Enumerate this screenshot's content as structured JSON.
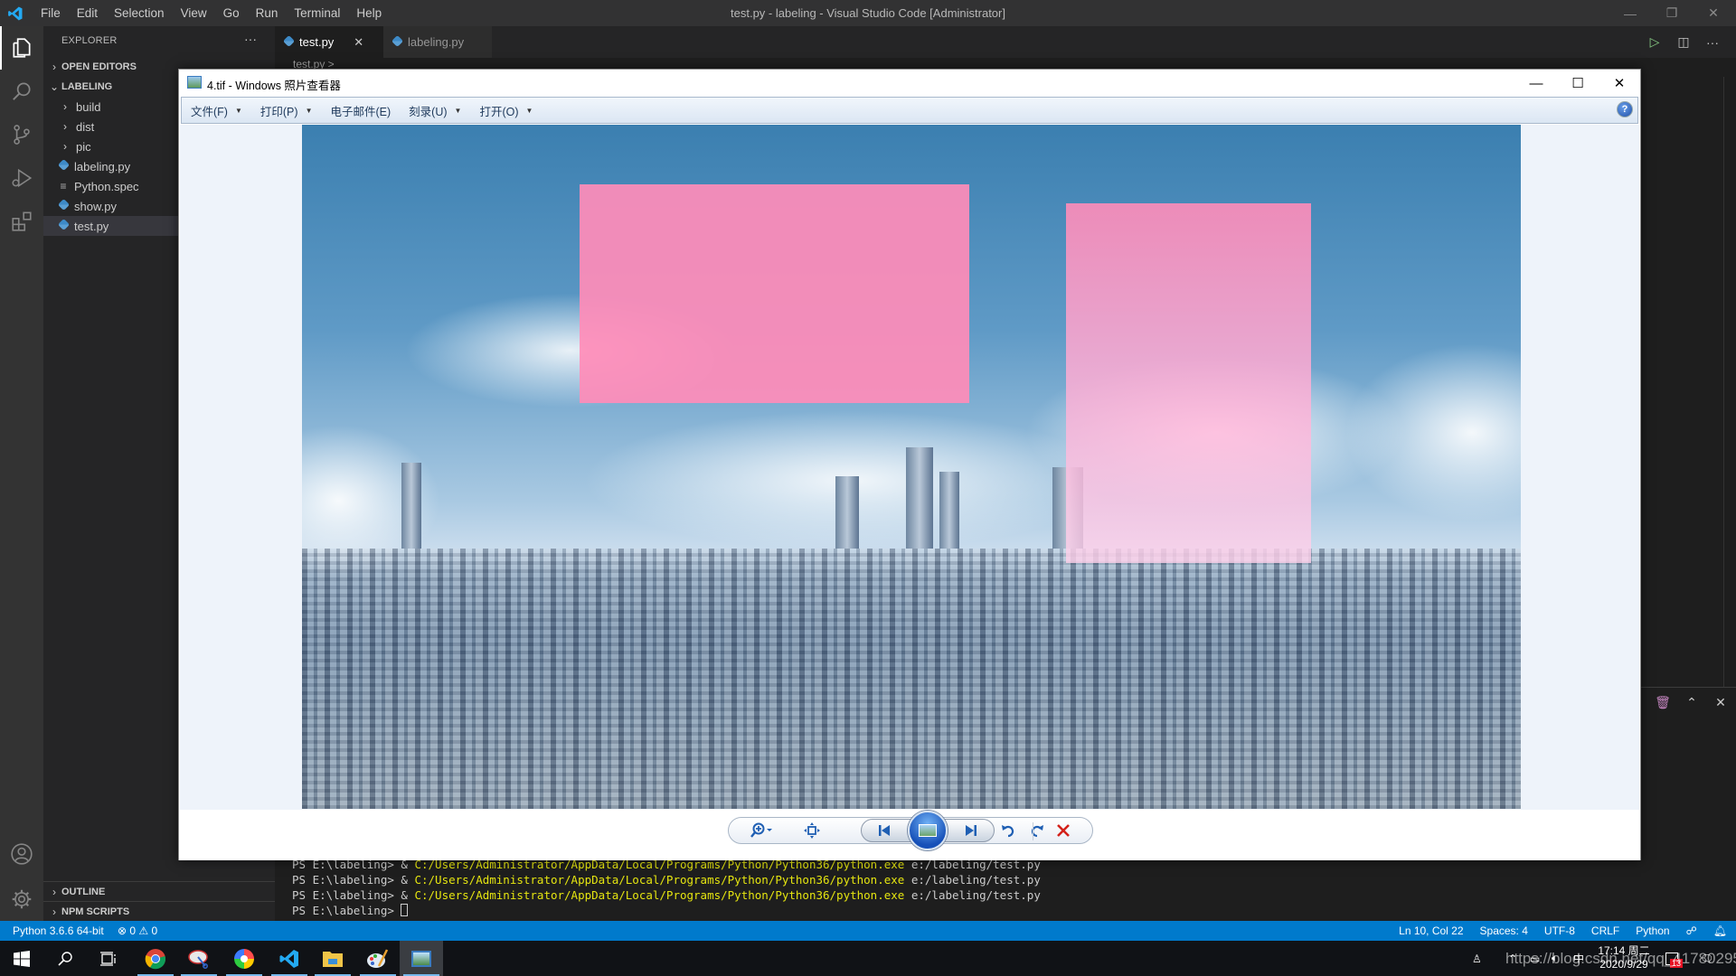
{
  "vscode": {
    "window_title": "test.py - labeling - Visual Studio Code [Administrator]",
    "menu": [
      "File",
      "Edit",
      "Selection",
      "View",
      "Go",
      "Run",
      "Terminal",
      "Help"
    ],
    "window_controls": {
      "minimize": "—",
      "restore": "❐",
      "close": "✕"
    },
    "activity_bar": [
      {
        "name": "explorer",
        "icon": "files-icon",
        "active": true
      },
      {
        "name": "search",
        "icon": "search-icon"
      },
      {
        "name": "source-control",
        "icon": "source-control-icon"
      },
      {
        "name": "run-debug",
        "icon": "run-debug-icon"
      },
      {
        "name": "extensions",
        "icon": "extensions-icon"
      },
      {
        "name": "accounts",
        "icon": "account-icon"
      },
      {
        "name": "manage",
        "icon": "gear-icon"
      }
    ],
    "sidebar": {
      "title": "EXPLORER",
      "more": "···",
      "open_editors": "OPEN EDITORS",
      "folder": "LABELING",
      "items": [
        {
          "label": "build",
          "type": "folder"
        },
        {
          "label": "dist",
          "type": "folder"
        },
        {
          "label": "pic",
          "type": "folder"
        },
        {
          "label": "labeling.py",
          "type": "python"
        },
        {
          "label": "Python.spec",
          "type": "spec"
        },
        {
          "label": "show.py",
          "type": "python"
        },
        {
          "label": "test.py",
          "type": "python",
          "selected": true
        }
      ],
      "outline": "OUTLINE",
      "npm_scripts": "NPM SCRIPTS"
    },
    "tabs": [
      {
        "label": "test.py",
        "active": true,
        "close": "✕"
      },
      {
        "label": "labeling.py",
        "active": false
      }
    ],
    "editor_actions": {
      "run": "▷",
      "split": "◫",
      "more": "···"
    },
    "breadcrumb": "test.py >",
    "panel_controls": {
      "trash": "🗑",
      "maximize": "⌃",
      "close": "✕"
    },
    "terminal": {
      "lines": [
        {
          "prompt": "PS E:\\labeling> & ",
          "path": "C:/Users/Administrator/AppData/Local/Programs/Python/Python36/python.exe",
          "arg": " e:/labeling/test.py"
        },
        {
          "prompt": "PS E:\\labeling> & ",
          "path": "C:/Users/Administrator/AppData/Local/Programs/Python/Python36/python.exe",
          "arg": " e:/labeling/test.py"
        },
        {
          "prompt": "PS E:\\labeling> & ",
          "path": "C:/Users/Administrator/AppData/Local/Programs/Python/Python36/python.exe",
          "arg": " e:/labeling/test.py"
        }
      ],
      "current_prompt": "PS E:\\labeling> "
    },
    "statusbar": {
      "interpreter": "Python 3.6.6 64-bit",
      "errors": "0",
      "warnings": "0",
      "position": "Ln 10, Col 22",
      "spaces": "Spaces: 4",
      "encoding": "UTF-8",
      "eol": "CRLF",
      "language": "Python",
      "feedback_icon": "feedback-icon",
      "bell_icon": "bell-icon"
    },
    "colors": {
      "accent": "#007acc",
      "terminal_path": "#e5e510"
    }
  },
  "photo_viewer": {
    "title": "4.tif - Windows 照片查看器",
    "window_controls": {
      "minimize": "—",
      "maximize": "☐",
      "close": "✕"
    },
    "menu": [
      {
        "label": "文件(F)",
        "dropdown": true
      },
      {
        "label": "打印(P)",
        "dropdown": true
      },
      {
        "label": "电子邮件(E)",
        "dropdown": false
      },
      {
        "label": "刻录(U)",
        "dropdown": true
      },
      {
        "label": "打开(O)",
        "dropdown": true
      }
    ],
    "help": "?",
    "image": {
      "description": "Anime cityscape under a cloudy blue sky with two pink rectangular overlays",
      "overlay_color": "#ff8cb9"
    },
    "toolbar": {
      "zoom": "zoom-icon",
      "fit": "actual-size-icon",
      "previous": "previous-icon",
      "slideshow": "slideshow-icon",
      "next": "next-icon",
      "rotate_ccw": "rotate-counterclockwise-icon",
      "rotate_cw": "rotate-clockwise-icon",
      "delete": "delete-icon"
    }
  },
  "taskbar": {
    "apps": [
      "start",
      "search",
      "task-view",
      "chrome",
      "snipping-tool",
      "color-app",
      "vscode",
      "file-explorer",
      "paint",
      "photo-viewer"
    ],
    "clock_time": "17:14 周二",
    "clock_date": "2020/9/29",
    "ime": "中",
    "notification_count": "13",
    "watermark": "https://blog.csdn.net/qq_41780295"
  }
}
